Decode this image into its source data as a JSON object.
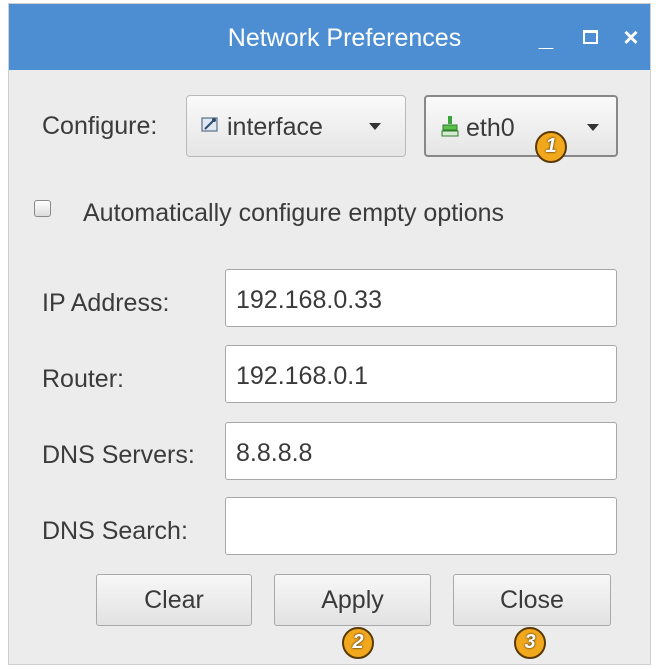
{
  "window": {
    "title": "Network Preferences",
    "controls": {
      "minimize": "_",
      "close": "×"
    }
  },
  "configure": {
    "label": "Configure:",
    "type_value": "interface",
    "interface_value": "eth0"
  },
  "auto_configure": {
    "label": "Automatically configure empty options",
    "checked": false
  },
  "fields": {
    "ip_address": {
      "label": "IP Address:",
      "value": "192.168.0.33"
    },
    "router": {
      "label": "Router:",
      "value": "192.168.0.1"
    },
    "dns_servers": {
      "label": "DNS Servers:",
      "value": "8.8.8.8"
    },
    "dns_search": {
      "label": "DNS Search:",
      "value": ""
    }
  },
  "buttons": {
    "clear": "Clear",
    "apply": "Apply",
    "close": "Close"
  },
  "markers": [
    "1",
    "2",
    "3"
  ],
  "colors": {
    "titlebar": "#4d8ed3",
    "window_bg": "#ececec",
    "marker": "#f2a81d"
  }
}
